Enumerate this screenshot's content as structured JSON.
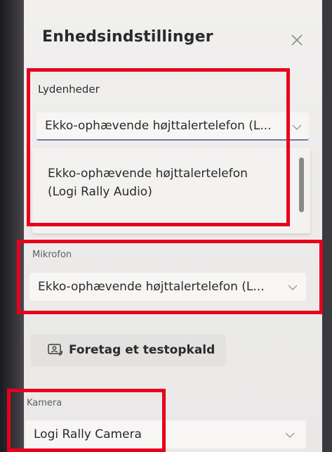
{
  "panel": {
    "title": "Enhedsindstillinger"
  },
  "speakers": {
    "label": "Lydenheder",
    "selected_value": "Ekko-ophævende højttalertelefon (L...",
    "option": "Ekko-ophævende højttalertelefon (Logi Rally Audio)"
  },
  "microphone": {
    "label": "Mikrofon",
    "selected_value": "Ekko-ophævende højttalertelefon (L..."
  },
  "test_call": {
    "label": "Foretag et testopkald"
  },
  "camera": {
    "label": "Kamera",
    "selected_value": "Logi Rally Camera"
  },
  "colors": {
    "highlight": "#e8001c",
    "panel_bg": "#ecebea",
    "accent_underline": "#6b78a8"
  }
}
